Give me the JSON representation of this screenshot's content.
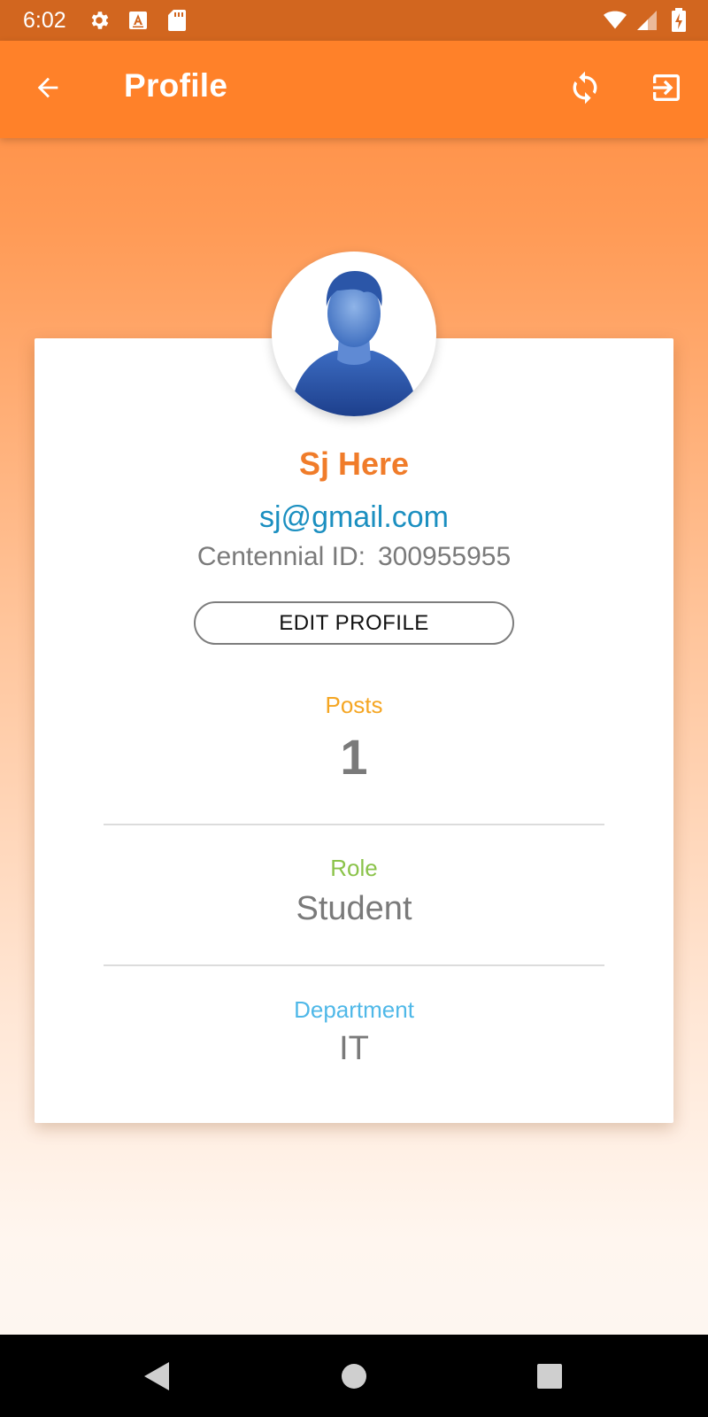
{
  "status_bar": {
    "time": "6:02",
    "icons_left": [
      "gear-icon",
      "a-box-icon",
      "sd-card-icon"
    ],
    "icons_right": [
      "wifi-icon",
      "signal-icon",
      "battery-charging-icon"
    ]
  },
  "app_bar": {
    "title": "Profile",
    "icons": [
      "back-arrow-icon",
      "refresh-icon",
      "logout-icon"
    ]
  },
  "profile": {
    "name": "Sj Here",
    "email": "sj@gmail.com",
    "id_label": "Centennial ID:",
    "id_value": "300955955",
    "edit_button": "EDIT PROFILE"
  },
  "stats": {
    "posts_label": "Posts",
    "posts_value": "1",
    "role_label": "Role",
    "role_value": "Student",
    "department_label": "Department",
    "department_value": "IT"
  },
  "colors": {
    "accent_orange": "#ff8129",
    "status_bar": "#d2661f",
    "name": "#f07c2a",
    "email": "#1b8fc0",
    "posts_label": "#f5a623",
    "role_label": "#8bc34a",
    "department_label": "#4fb8e8"
  },
  "nav_bar": {
    "icons": [
      "back-triangle-icon",
      "home-circle-icon",
      "recents-square-icon"
    ]
  }
}
